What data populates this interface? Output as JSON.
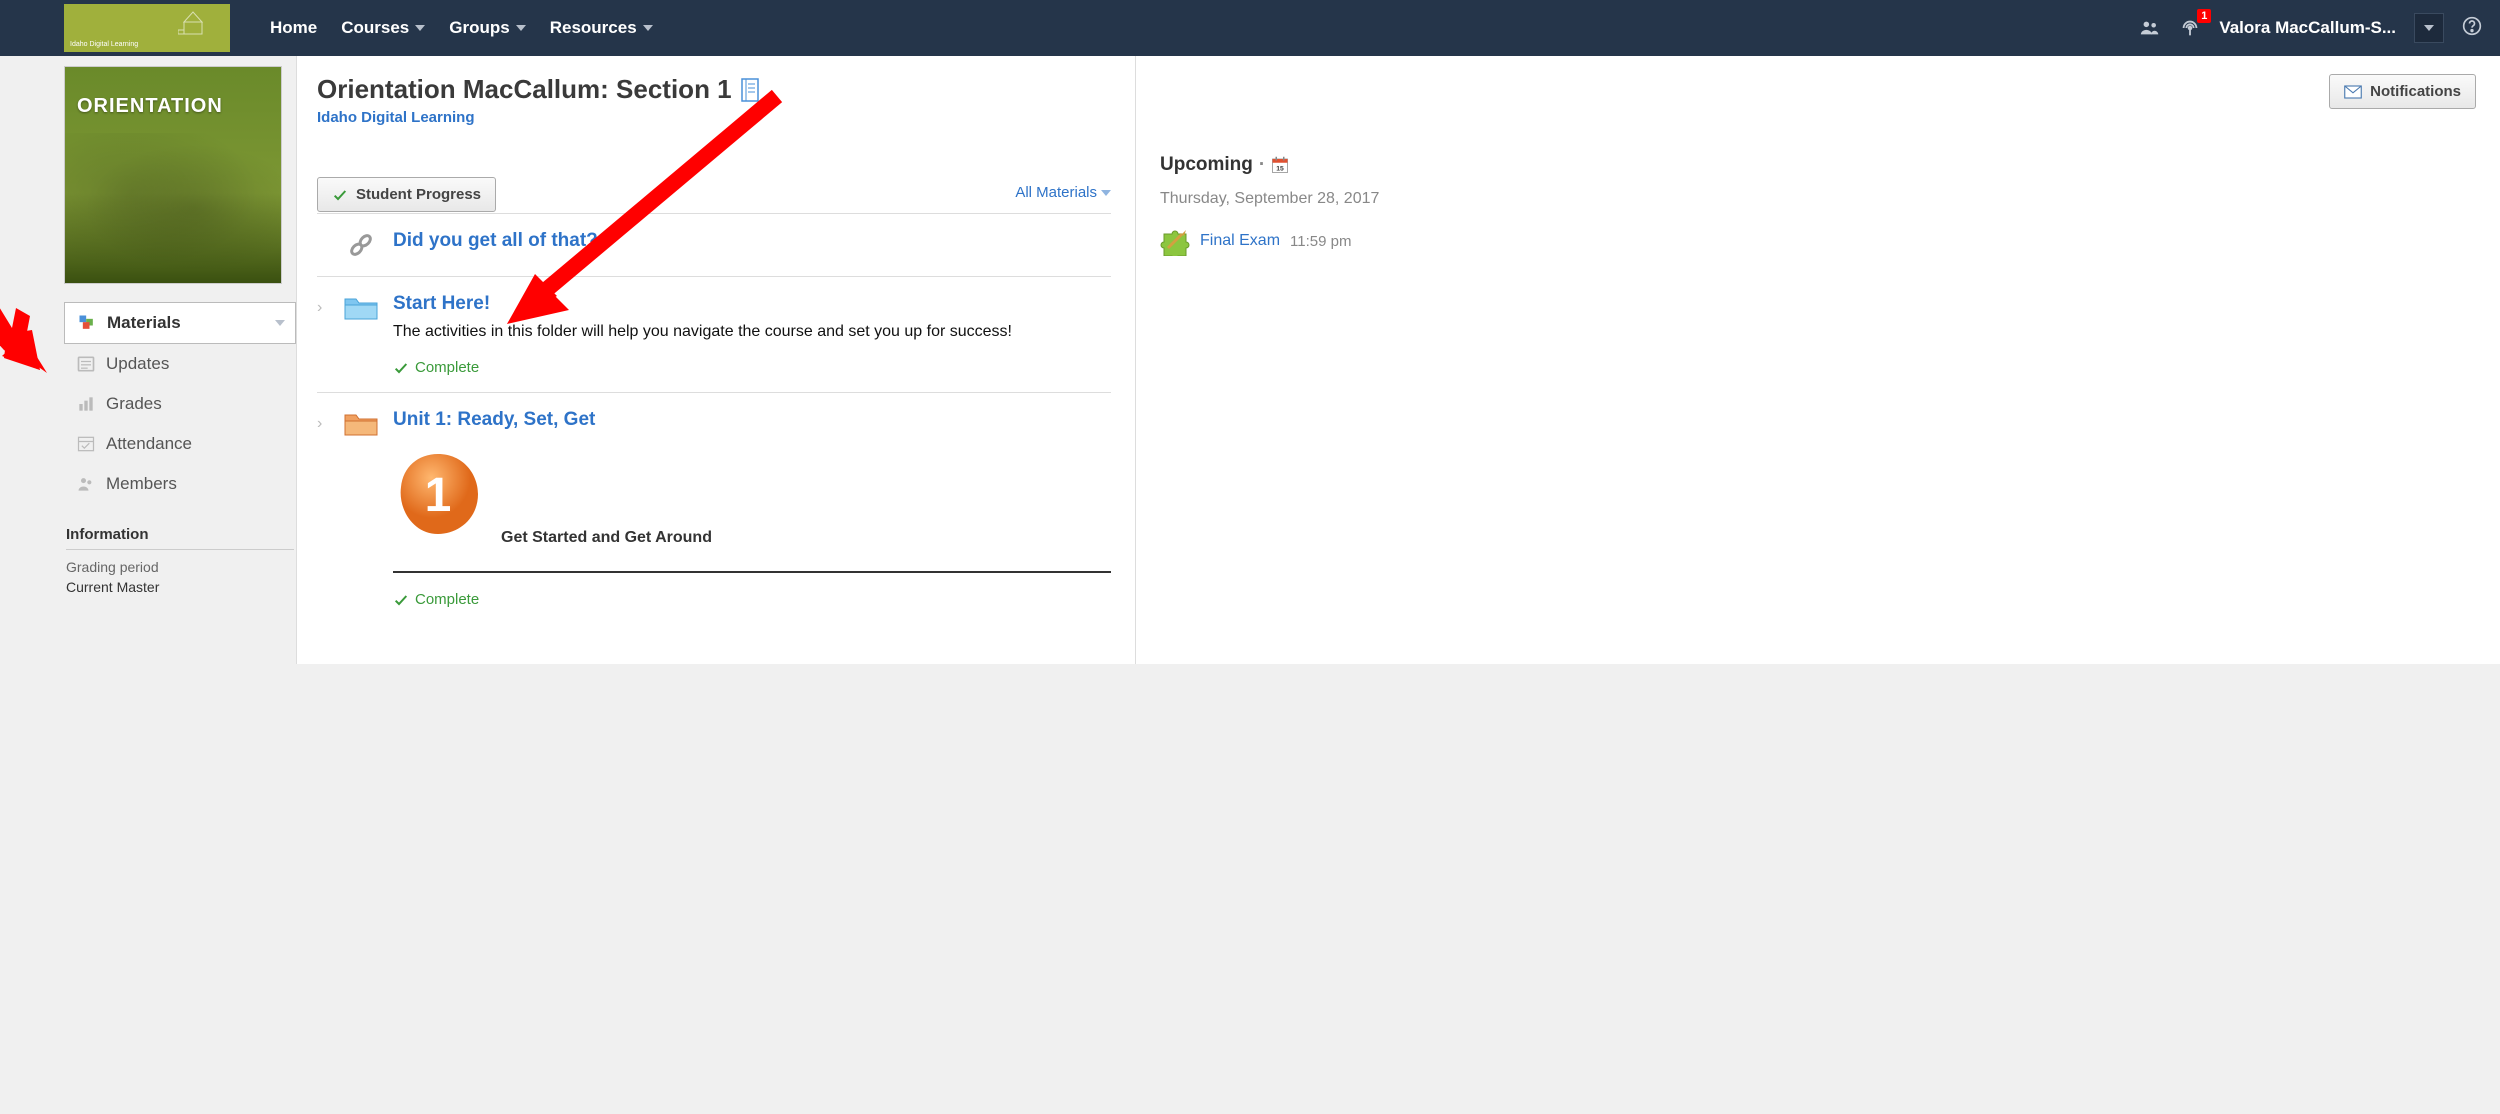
{
  "nav": {
    "home": "Home",
    "courses": "Courses",
    "groups": "Groups",
    "resources": "Resources",
    "user_name": "Valora MacCallum-S...",
    "badge": "1",
    "logo_text": "Idaho\nDigital Learning"
  },
  "sidebar": {
    "course_image_label": "ORIENTATION",
    "items": [
      {
        "label": "Materials",
        "active": true
      },
      {
        "label": "Updates"
      },
      {
        "label": "Grades"
      },
      {
        "label": "Attendance"
      },
      {
        "label": "Members"
      }
    ],
    "info_header": "Information",
    "info_label": "Grading period",
    "info_value": "Current Master"
  },
  "main": {
    "title": "Orientation MacCallum: Section 1",
    "school": "Idaho Digital Learning",
    "progress_btn": "Student Progress",
    "filter": "All Materials",
    "items": [
      {
        "title": "Did you get all of that?",
        "type": "link"
      },
      {
        "title": "Start Here!",
        "type": "folder-blue",
        "desc": "The activities in this folder will help you navigate the course and set you up for success!",
        "status": "Complete"
      },
      {
        "title": "Unit 1: Ready, Set, Get",
        "type": "folder-orange",
        "subtitle": "Get Started and Get Around",
        "status": "Complete"
      }
    ]
  },
  "right": {
    "notifications_btn": "Notifications",
    "upcoming_hdr": "Upcoming",
    "date": "Thursday, September 28, 2017",
    "event_title": "Final Exam",
    "event_time": "11:59 pm"
  }
}
